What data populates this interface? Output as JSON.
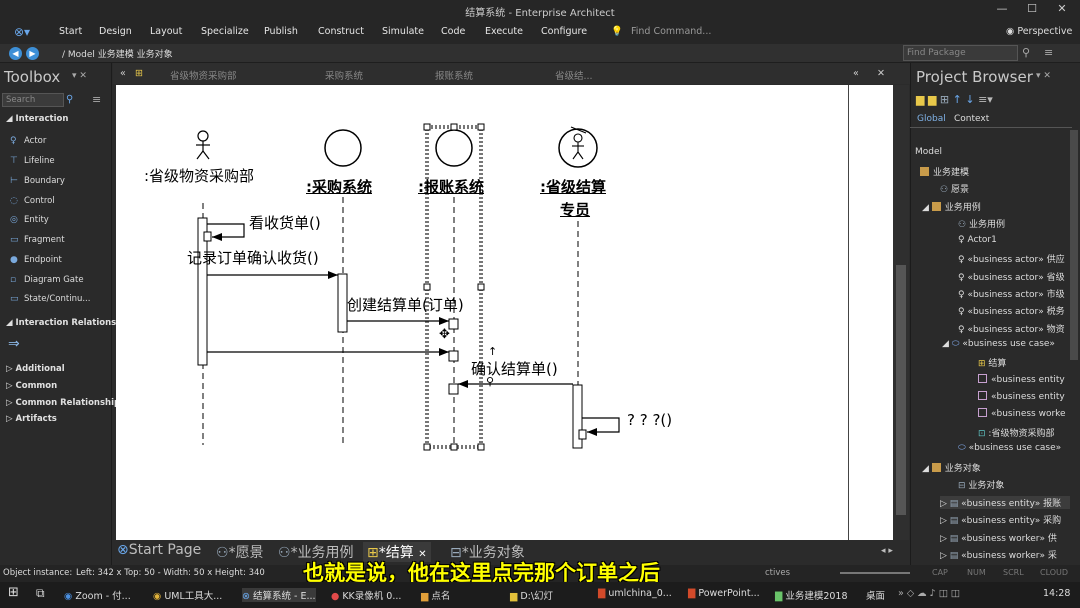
{
  "window": {
    "title": "结算系统 - Enterprise Architect"
  },
  "menu": [
    "Start",
    "Design",
    "Layout",
    "Specialize",
    "Publish",
    "Construct",
    "Simulate",
    "Code",
    "Execute",
    "Configure"
  ],
  "find_command": "Find Command...",
  "perspective": "Perspective",
  "breadcrumb": "/  Model  业务建模  业务对象",
  "find_package_placeholder": "Find Package",
  "toolbox": {
    "title": "Toolbox",
    "search_placeholder": "Search",
    "section_interaction": "Interaction",
    "items": [
      "Actor",
      "Lifeline",
      "Boundary",
      "Control",
      "Entity",
      "Fragment",
      "Endpoint",
      "Diagram Gate",
      "State/Continu..."
    ],
    "section_relationships": "Interaction Relationsh",
    "sections": [
      "Additional",
      "Common",
      "Common Relationship",
      "Artifacts"
    ]
  },
  "diagram_tabs": [
    "省级物资采购部",
    "采购系统",
    "报账系统",
    "省级结..."
  ],
  "diagram": {
    "lifeline1": ":省级物资采购部",
    "lifeline2": ":采购系统",
    "lifeline3": ":报账系统",
    "lifeline4_line1": ":省级结算",
    "lifeline4_line2": "专员",
    "msg1": "看收货单()",
    "msg2": "记录订单确认收货()",
    "msg3": "创建结算单(订单)",
    "msg4": "确认结算单()",
    "msg5": "? ? ?()"
  },
  "bottom_tabs": [
    "Start Page",
    "*愿景",
    "*业务用例",
    "*结算",
    "*业务对象"
  ],
  "project_browser": {
    "title": "Project Browser",
    "tab_global": "Global",
    "tab_context": "Context",
    "items": [
      "Model",
      "业务建模",
      "愿景",
      "业务用例",
      "业务用例",
      "Actor1",
      "«business actor» 供应",
      "«business actor» 省级",
      "«business actor» 市级",
      "«business actor» 税务",
      "«business actor» 物资",
      "«business use case» ",
      "结算",
      "«business entity",
      "«business entity",
      "«business worke",
      ":省级物资采购部",
      "«business use case» ",
      "业务对象",
      "业务对象",
      "«business entity» 报账",
      "«business entity» 采购",
      "«business worker» 供",
      "«business worker» 采"
    ]
  },
  "status": {
    "object_instance": "Object instance:",
    "left": "Left:   342 x Top:   50 - Width:   50 x Height:   340",
    "perspectives": "ctives",
    "indicators": [
      "CAP",
      "NUM",
      "SCRL",
      "CLOUD"
    ]
  },
  "subtitle": "也就是说，他在这里点完那个订单之后",
  "taskbar": {
    "items": [
      "Zoom - 付...",
      "UML工具大...",
      "结算系统 - E...",
      "KK录像机 0...",
      "点名",
      "D:\\幻灯",
      "umlchina_0...",
      "PowerPoint...",
      "业务建模2018"
    ],
    "desktop": "桌面",
    "clock": "14:28"
  }
}
